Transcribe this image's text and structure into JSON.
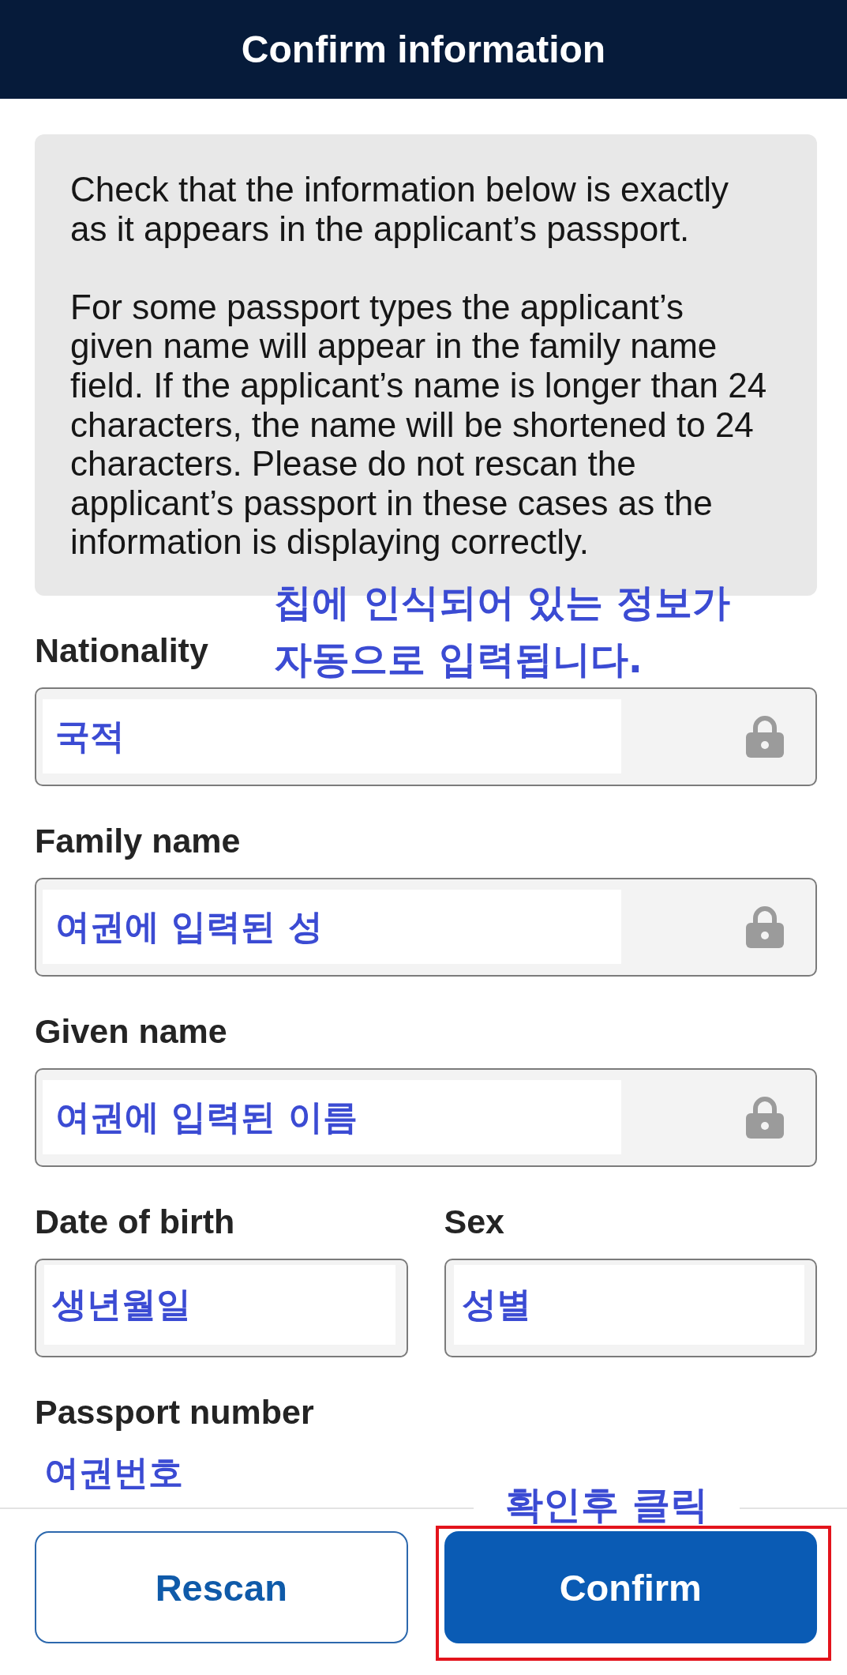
{
  "header": {
    "title": "Confirm information"
  },
  "notice": {
    "paragraphs": [
      "Check that the information below is exactly as it appears in the applicant’s passport.",
      "For some passport types the applicant’s given name will appear in the family name field. If the applicant’s name is longer than 24 characters, the name will be shortened to 24 characters. Please do not rescan the applicant’s passport in these cases as the information is displaying correctly."
    ]
  },
  "callout": {
    "text": "칩에 인식되어 있는 정보가\n자동으로 입력됩니다."
  },
  "form": {
    "rows": [
      [
        {
          "label": "Nationality",
          "kind": "boxed",
          "value": "국적",
          "locked": true
        }
      ],
      [
        {
          "label": "Family name",
          "kind": "boxed",
          "value": "여권에 입력된 성",
          "locked": true
        }
      ],
      [
        {
          "label": "Given name",
          "kind": "boxed",
          "value": "여권에 입력된 이름",
          "locked": true
        }
      ],
      [
        {
          "label": "Date of birth",
          "kind": "boxed",
          "value": "생년월일",
          "locked": false
        },
        {
          "label": "Sex",
          "kind": "boxed",
          "value": "성별",
          "locked": false
        }
      ],
      [
        {
          "label": "Passport number",
          "kind": "open",
          "value": "여권번호",
          "locked": false
        }
      ]
    ]
  },
  "footer": {
    "callout": "확인후 클릭",
    "buttons": [
      {
        "label": "Rescan",
        "kind": "secondary",
        "highlighted": false
      },
      {
        "label": "Confirm",
        "kind": "primary",
        "highlighted": true
      }
    ]
  }
}
